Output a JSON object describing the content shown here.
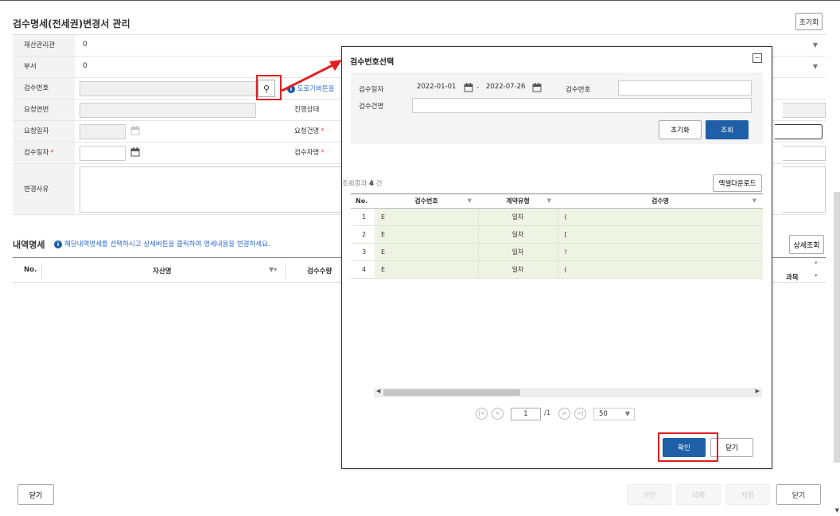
{
  "page": {
    "title": "검수명세(전세권)변경서 관리",
    "reset_label": "초기화"
  },
  "form": {
    "asset_org_label": "재산관리관",
    "asset_org_value": "0",
    "dept_label": "부서",
    "dept_value": "0",
    "inspect_no_label": "검수번호",
    "inspect_no_value": "",
    "link_text": "도로기버튼을",
    "request_no_label": "요청연번",
    "progress_label": "진행상태",
    "request_date_label": "요청일자",
    "requester_label": "요청건명",
    "inspect_date_label": "검수일자",
    "inspector_label": "검수자명",
    "reason_label": "변경사유",
    "required_mark": "*"
  },
  "details": {
    "title": "내역명세",
    "hint": "해당내역명세를 선택하시고 상세버튼을 클릭하여 명세내용을 변경하세요.",
    "detail_button": "상세조회",
    "columns": [
      "No.",
      "자산명",
      "검수수량"
    ],
    "right_col_label": "과목"
  },
  "footer": {
    "close_left": "닫기",
    "btn_disabled_1": "기안",
    "btn_disabled_2": "삭제",
    "btn_disabled_3": "저장",
    "close_right": "닫기"
  },
  "modal": {
    "title": "검수번호선택",
    "minimize_icon": "−",
    "date_label": "검수일자",
    "date_from": "2022-01-01",
    "date_sep": "-",
    "date_to": "2022-07-26",
    "inspect_no_label": "검수번호",
    "inspect_no_value": "",
    "case_name_label": "검수건명",
    "case_name_value": "",
    "reset_label": "초기화",
    "query_label": "조회",
    "count_prefix": "조회결과",
    "count_value": "4",
    "count_suffix": "건",
    "excel_label": "엑셀다운로드",
    "columns": [
      "No.",
      "검수번호",
      "계약유형",
      "검수명"
    ],
    "rows": [
      {
        "no": "1",
        "inspect_no": "E",
        "type": "일차",
        "name": "("
      },
      {
        "no": "2",
        "inspect_no": "E",
        "type": "일차",
        "name": "["
      },
      {
        "no": "3",
        "inspect_no": "E",
        "type": "일차",
        "name": "!"
      },
      {
        "no": "4",
        "inspect_no": "E",
        "type": "일차",
        "name": "("
      }
    ],
    "pager": {
      "current": "1",
      "total": "/1",
      "page_size": "50"
    },
    "confirm_label": "확인",
    "close_label": "닫기"
  },
  "colors": {
    "primary_button": "#1f5fa8",
    "highlight": "#e02020",
    "row_selected": "#eef3e3"
  }
}
